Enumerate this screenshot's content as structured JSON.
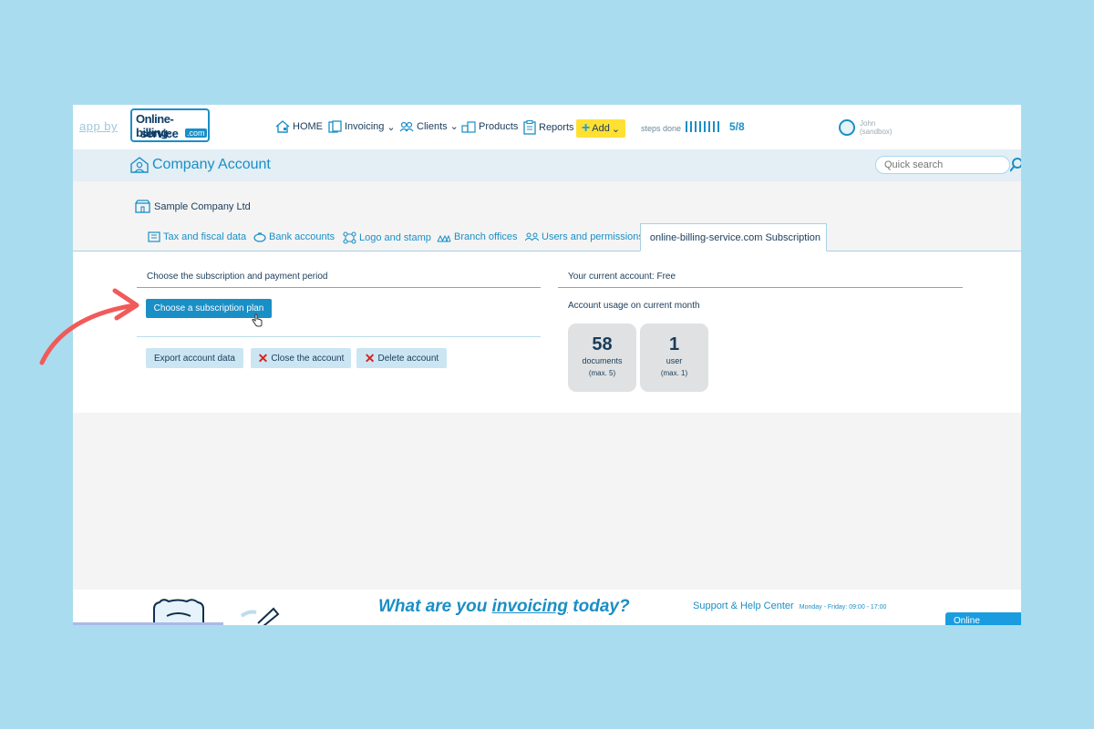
{
  "topnav": {
    "app_by": "app by",
    "logo_line1": "Online-billing-",
    "logo_line2": "service",
    "logo_tld": ".com",
    "items": [
      {
        "label": "HOME"
      },
      {
        "label": "Invoicing"
      },
      {
        "label": "Clients"
      },
      {
        "label": "Products"
      },
      {
        "label": "Reports"
      }
    ],
    "add_label": "Add",
    "steps_label": "steps done",
    "steps_count": "5/8",
    "user_name": "John",
    "user_env": "(sandbox)"
  },
  "header": {
    "title": "Company Account",
    "search_placeholder": "Quick search"
  },
  "company": {
    "name": "Sample Company Ltd"
  },
  "tabs": [
    {
      "label": "Tax and fiscal data"
    },
    {
      "label": "Bank accounts"
    },
    {
      "label": "Logo and stamp"
    },
    {
      "label": "Branch offices"
    },
    {
      "label": "Users and permissions"
    },
    {
      "label": "online-billing-service.com Subscription"
    }
  ],
  "subscription": {
    "section_title": "Choose the subscription and payment period",
    "choose_plan_label": "Choose a subscription plan",
    "export_label": "Export account data",
    "close_label": "Close the account",
    "delete_label": "Delete account"
  },
  "account": {
    "current_label": "Your current account: Free",
    "usage_label": "Account usage on current month",
    "cards": [
      {
        "value": "58",
        "label": "documents",
        "max": "(max. 5)"
      },
      {
        "value": "1",
        "label": "user",
        "max": "(max. 1)"
      }
    ]
  },
  "footer": {
    "tagline_1": "What are ",
    "tagline_you": "you",
    "tagline_invoicing": "invoicing",
    "tagline_2": " today?",
    "support_title": "Support & Help Center",
    "support_hours": "Monday - Friday: 09:00 - 17:00",
    "online_label": "Online"
  },
  "colors": {
    "background": "#aadcf0",
    "accent": "#1a8fc6",
    "add_button": "#ffe033",
    "danger": "#d8231e",
    "annotation_arrow": "#f25a5a"
  }
}
